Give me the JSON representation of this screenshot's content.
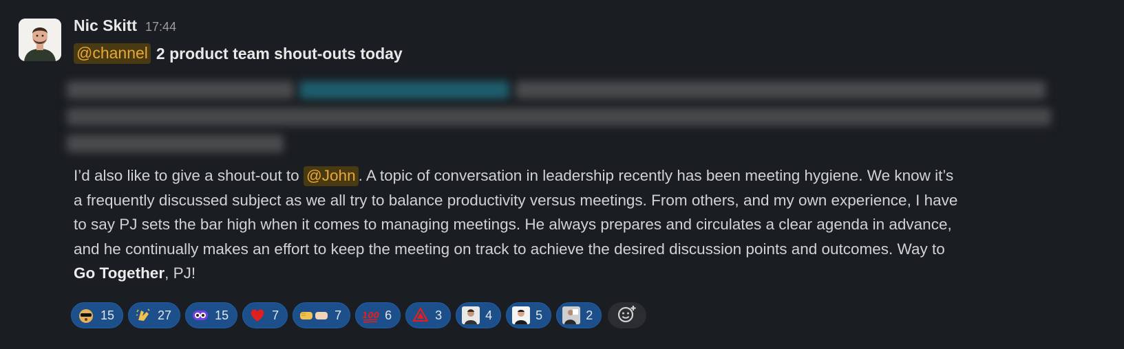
{
  "message": {
    "author": "Nic Skitt",
    "timestamp": "17:44",
    "channel_mention": "@channel",
    "title": "2 product team shout-outs today",
    "body": {
      "line1_before": "I’d also like to give a shout-out to ",
      "user_mention": "@John",
      "line1_after": ". A topic of conversation in leadership recently has been meeting hygiene. We know it’s",
      "line2": "a frequently discussed subject as we all try to balance productivity versus meetings. From others, and my own experience, I have",
      "line3": "to say PJ sets the bar high when it comes to managing meetings. He always prepares and circulates a clear agenda in advance,",
      "line4": "and he continually makes an effort to keep the meeting on track to achieve the desired discussion points and outcomes. Way to",
      "line5_bold": "Go Together",
      "line5_after": ", PJ!"
    }
  },
  "reactions": [
    {
      "icon": "dog-sunglasses-emoji",
      "count": "15"
    },
    {
      "icon": "clapping-hands-emoji",
      "count": "27"
    },
    {
      "icon": "purple-eyes-emoji",
      "count": "15"
    },
    {
      "icon": "red-heart-emoji",
      "count": "7"
    },
    {
      "icon": "fist-bump-emoji",
      "count": "7"
    },
    {
      "icon": "hundred-points-emoji",
      "count": "6"
    },
    {
      "icon": "red-alert-emoji",
      "count": "3"
    },
    {
      "icon": "person-avatar-emoji-1",
      "count": "4"
    },
    {
      "icon": "person-avatar-emoji-2",
      "count": "5"
    },
    {
      "icon": "person-avatar-emoji-3",
      "count": "2"
    }
  ],
  "colors": {
    "background": "#1a1d21",
    "mention_bg": "#4a3a12",
    "mention_text": "#e8a838",
    "reaction_bg": "#1d4f8a",
    "reaction_border": "#1e5fa8"
  }
}
